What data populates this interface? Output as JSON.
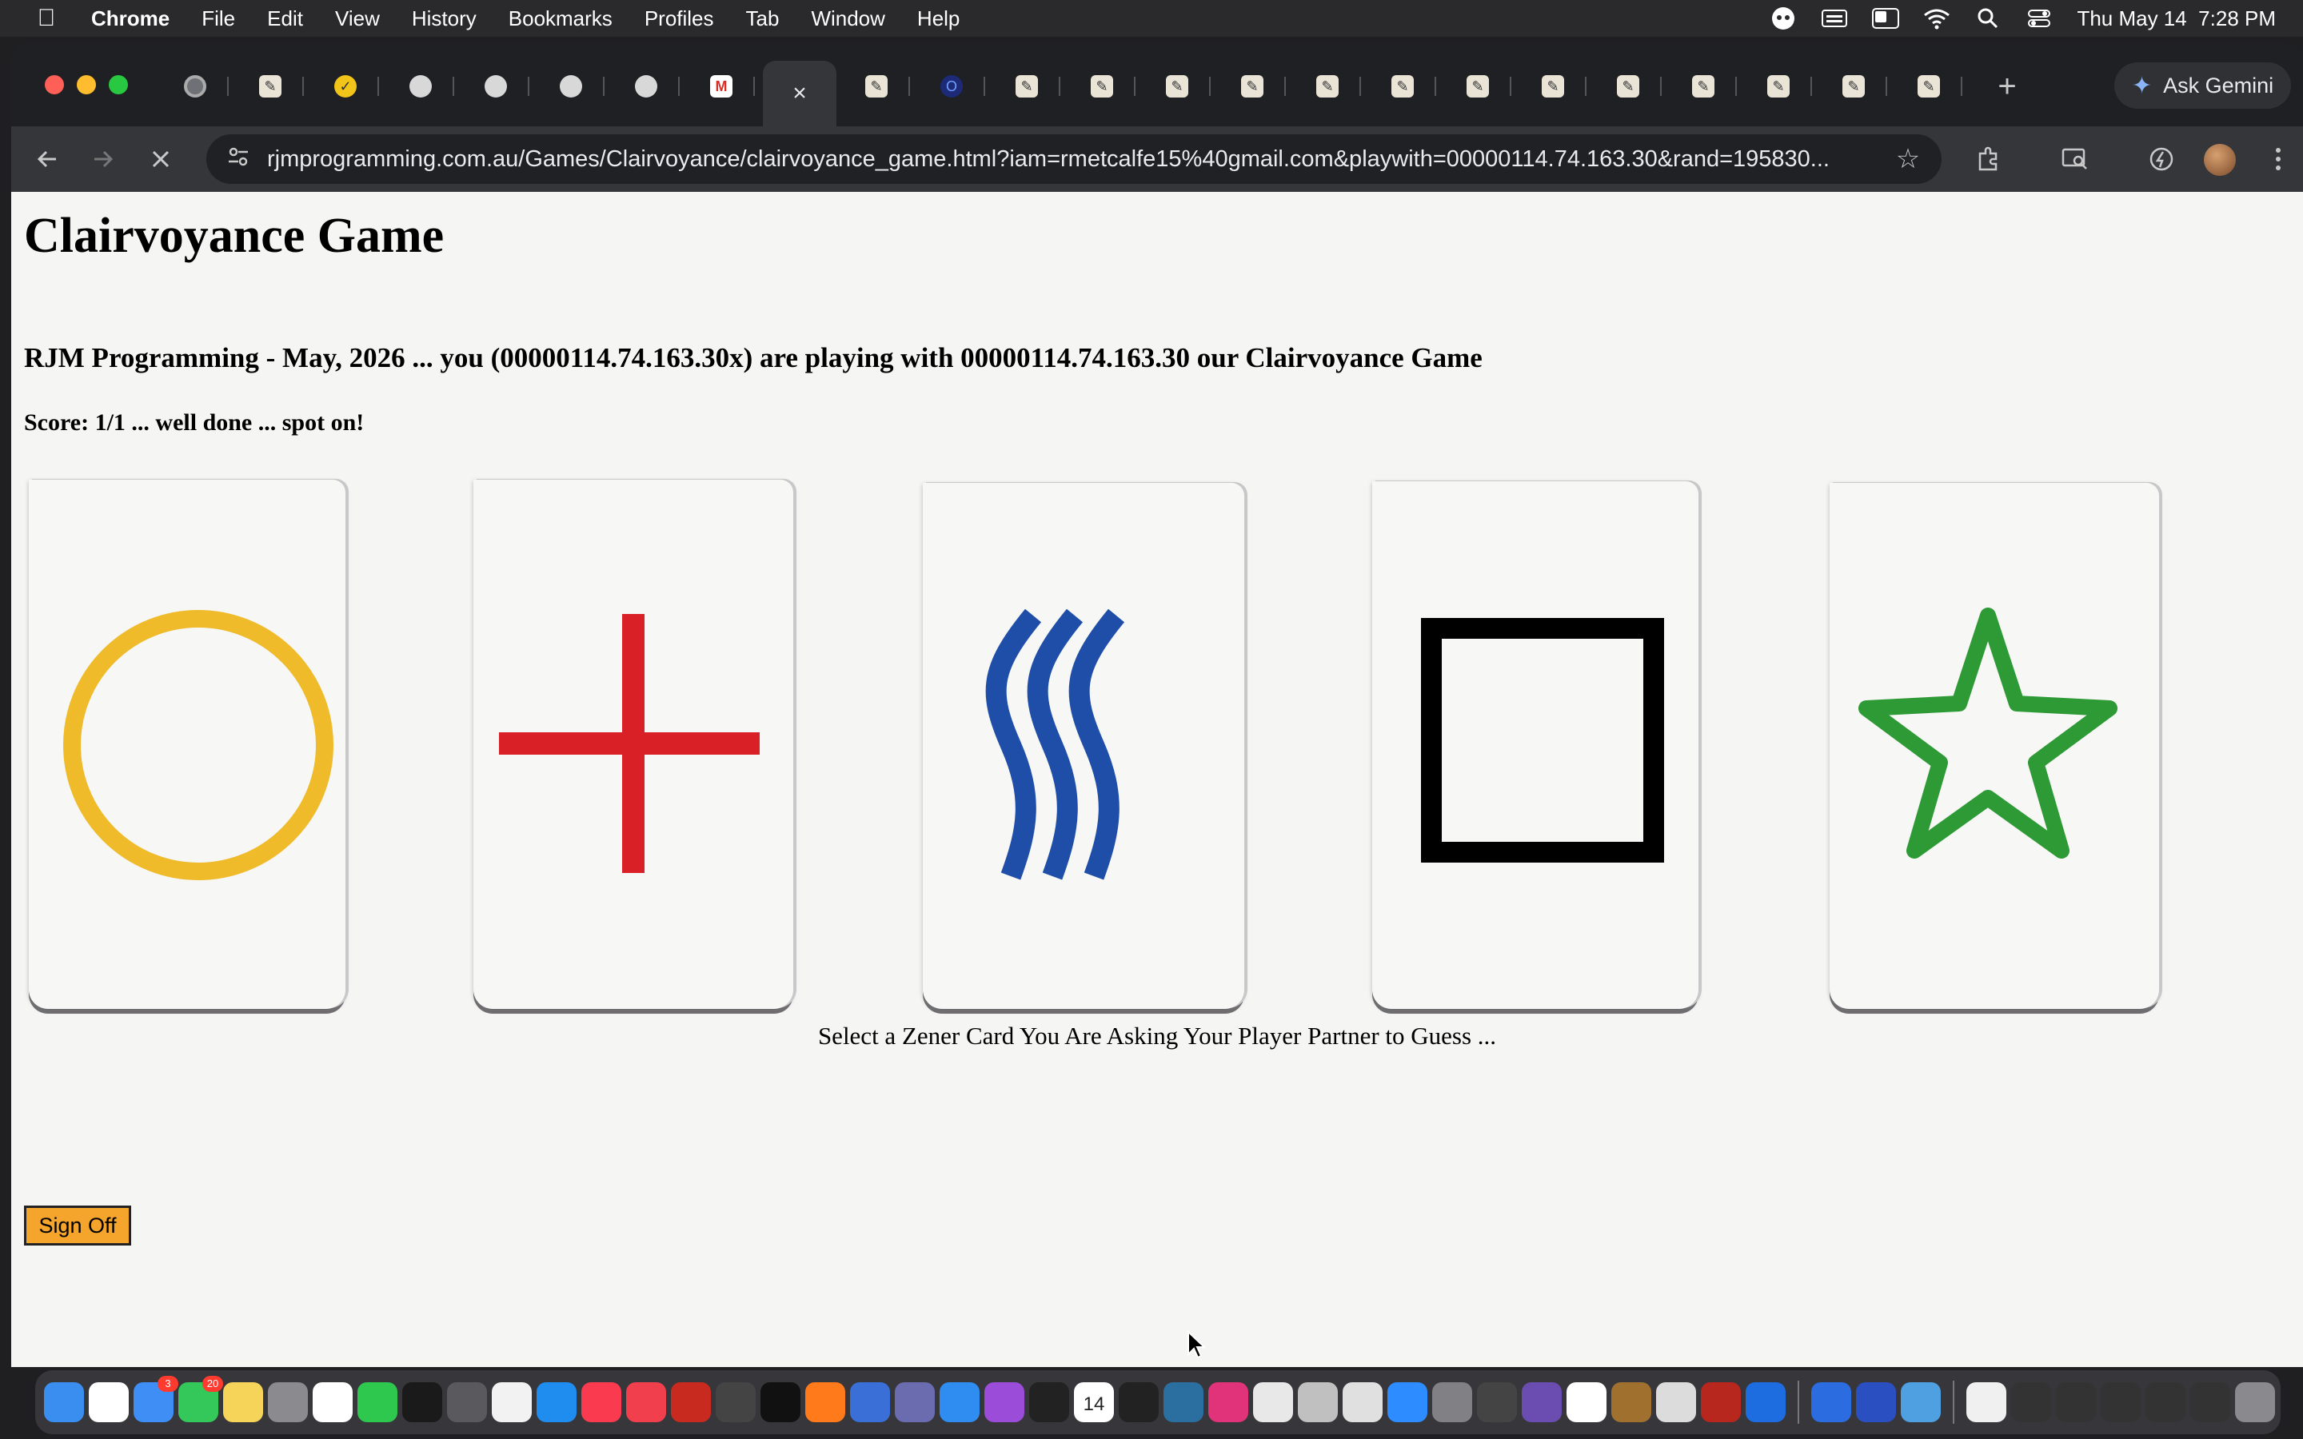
{
  "menubar": {
    "app_name": "Chrome",
    "items": [
      "File",
      "Edit",
      "View",
      "History",
      "Bookmarks",
      "Profiles",
      "Tab",
      "Window",
      "Help"
    ],
    "datetime": "Thu May 14  7:28 PM"
  },
  "browser": {
    "ask_gemini_label": "Ask Gemini",
    "url": "rjmprogramming.com.au/Games/Clairvoyance/clairvoyance_game.html?iam=rmetcalfe15%40gmail.com&playwith=00000114.74.163.30&rand=195830..."
  },
  "page": {
    "title": "Clairvoyance Game",
    "subtitle": "RJM Programming - May, 2026 ... you (00000114.74.163.30x) are playing with 00000114.74.163.30 our Clairvoyance Game",
    "score": "Score: 1/1 ... well done ... spot on!",
    "instruction": "Select a Zener Card You Are Asking Your Player Partner to Guess ...",
    "signoff_label": "Sign Off"
  },
  "cards": [
    {
      "symbol": "circle",
      "color": "#efbb2a"
    },
    {
      "symbol": "cross",
      "color": "#d92027"
    },
    {
      "symbol": "waves",
      "color": "#1f4ea8"
    },
    {
      "symbol": "square",
      "color": "#000000"
    },
    {
      "symbol": "star",
      "color": "#2e9a35"
    }
  ],
  "tabs": [
    "chrome-icon",
    "note-icon",
    "check-icon",
    "elephant-icon",
    "elephant-icon",
    "elephant-icon",
    "elephant-icon",
    "gmail-icon",
    "active-tab",
    "note-icon",
    "opera-icon",
    "note-icon",
    "note-icon",
    "note-icon",
    "note-icon",
    "note-icon",
    "note-icon",
    "note-icon",
    "note-icon",
    "note-icon",
    "note-icon",
    "note-icon",
    "note-icon",
    "note-icon"
  ],
  "dock": {
    "mail_badge": "3",
    "messages_badge": "20",
    "calendar_day": "14"
  }
}
